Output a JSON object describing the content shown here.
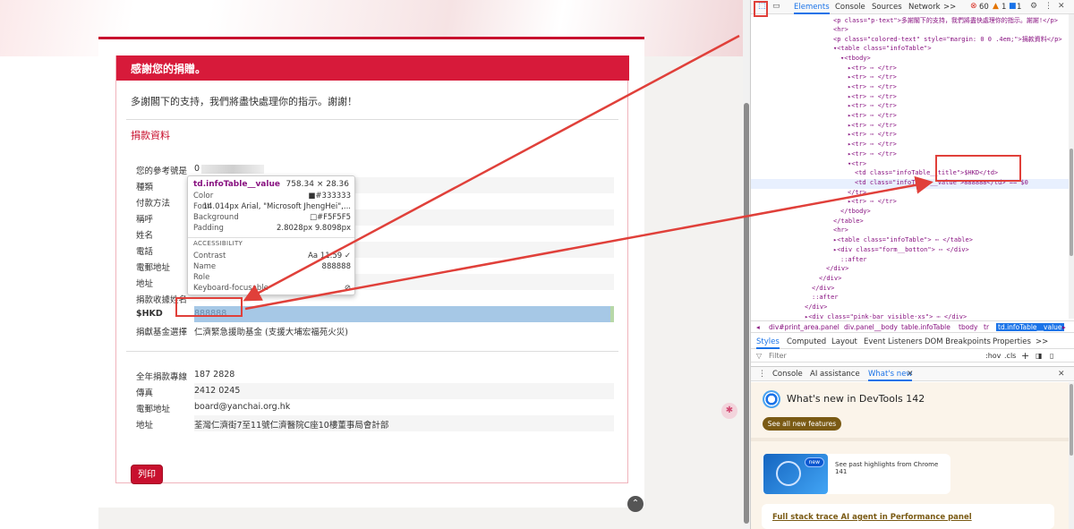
{
  "page": {
    "thank_title": "感謝您的捐贈。",
    "thank_text": "多謝閣下的支持，我們將盡快處理你的指示。謝謝！",
    "donation_heading": "捐款資料",
    "rows": [
      {
        "label": "您的參考號是",
        "value": "0"
      },
      {
        "label": "種類",
        "value": ""
      },
      {
        "label": "付款方法",
        "value": ""
      },
      {
        "label": "稱呼",
        "value": ""
      },
      {
        "label": "姓名",
        "value": ""
      },
      {
        "label": "電話",
        "value": ""
      },
      {
        "label": "電郵地址",
        "value": ""
      },
      {
        "label": "地址",
        "value": ""
      },
      {
        "label": "捐款收據姓名",
        "value": ""
      },
      {
        "label": "$HKD",
        "value": "888888"
      },
      {
        "label": "捐獻基金選擇",
        "value": "仁濟緊急援助基金 (支援大埔宏福苑火災)"
      }
    ],
    "contact_rows": [
      {
        "label": "全年捐款專線",
        "value": "187 2828"
      },
      {
        "label": "傳真",
        "value": "2412 0245"
      },
      {
        "label": "電郵地址",
        "value": "board@yanchai.org.hk"
      },
      {
        "label": "地址",
        "value": "荃灣仁濟街7至11號仁濟醫院C座10樓董事局會計部"
      }
    ],
    "print_label": "列印"
  },
  "tooltip": {
    "title": "td.infoTable__value",
    "size": "758.34 × 28.36",
    "color_label": "Color",
    "color_value": "■#333333",
    "font_label": "Font",
    "font_value": "14.014px Arial, \"Microsoft JhengHei\",...",
    "background_label": "Background",
    "background_value": "□#F5F5F5",
    "padding_label": "Padding",
    "padding_value": "2.8028px 9.8098px",
    "accessibility_label": "ACCESSIBILITY",
    "contrast_label": "Contrast",
    "contrast_value": "Aa 11.59 ✓",
    "name_label": "Name",
    "name_value": "888888",
    "role_label": "Role",
    "keyboard_label": "Keyboard-focusable",
    "keyboard_value": "⊘"
  },
  "devtools": {
    "tabs": [
      "Elements",
      "Console",
      "Sources",
      "Network"
    ],
    "more": ">>",
    "error_count": "60",
    "warning_count": "1",
    "info_count": "1",
    "code_lines": [
      {
        "indent": 0,
        "html": "<p class=\"p-text\">多謝閣下的支持，我們將盡快處理你的指示。謝謝!</p>"
      },
      {
        "indent": 0,
        "html": "<hr>"
      },
      {
        "indent": 0,
        "html": "<p class=\"colored-text\" style=\"margin: 0 0 .4em;\">捐款資料</p>"
      },
      {
        "indent": 0,
        "html": "▾<table class=\"infoTable\">"
      },
      {
        "indent": 1,
        "html": "▾<tbody>"
      },
      {
        "indent": 2,
        "html": "▸<tr> ⋯ </tr>"
      },
      {
        "indent": 2,
        "html": "▸<tr> ⋯ </tr>"
      },
      {
        "indent": 2,
        "html": "▸<tr> ⋯ </tr>"
      },
      {
        "indent": 2,
        "html": "▸<tr> ⋯ </tr>"
      },
      {
        "indent": 2,
        "html": "▸<tr> ⋯ </tr>"
      },
      {
        "indent": 2,
        "html": "▸<tr> ⋯ </tr>"
      },
      {
        "indent": 2,
        "html": "▸<tr> ⋯ </tr>"
      },
      {
        "indent": 2,
        "html": "▸<tr> ⋯ </tr>"
      },
      {
        "indent": 2,
        "html": "▸<tr> ⋯ </tr>"
      },
      {
        "indent": 2,
        "html": "▸<tr> ⋯ </tr>"
      },
      {
        "indent": 2,
        "html": "▾<tr>"
      },
      {
        "indent": 3,
        "html": "<td class=\"infoTable__title\">$HKD</td>"
      },
      {
        "indent": 3,
        "html": "<td class=\"infoTable__value\">888888</td> == $0"
      },
      {
        "indent": 2,
        "html": "</tr>"
      },
      {
        "indent": 2,
        "html": "▸<tr> ⋯ </tr>"
      },
      {
        "indent": 1,
        "html": "</tbody>"
      },
      {
        "indent": 0,
        "html": "</table>"
      },
      {
        "indent": 0,
        "html": "<hr>"
      },
      {
        "indent": 0,
        "html": "▸<table class=\"infoTable\"> ⋯ </table>"
      },
      {
        "indent": 0,
        "html": "▸<div class=\"form__botton\"> ⋯ </div>"
      },
      {
        "indent": 1,
        "html": "::after"
      },
      {
        "indent": -1,
        "html": "</div>"
      },
      {
        "indent": -2,
        "html": "</div>"
      },
      {
        "indent": -3,
        "html": "</div>"
      },
      {
        "indent": -3,
        "html": "::after"
      },
      {
        "indent": -4,
        "html": "</div>"
      },
      {
        "indent": -4,
        "html": "▸<div class=\"pink-bar visible-xs\"> ⋯ </div>"
      }
    ],
    "breadcrumbs": [
      "◂",
      "div#print_area.panel",
      "div.panel__body",
      "table.infoTable",
      "tbody",
      "tr",
      "td.infoTable__value",
      "▸"
    ],
    "style_tabs": [
      "Styles",
      "Computed",
      "Layout",
      "Event Listeners",
      "DOM Breakpoints",
      "Properties",
      ">>"
    ],
    "filter_placeholder": "Filter",
    "filter_tools": [
      ":hov",
      ".cls",
      "+"
    ],
    "drawer_tabs": [
      "Console",
      "AI assistance",
      "What's new"
    ],
    "whats_new_title": "What's new in DevTools 142",
    "see_all_features": "See all new features",
    "new_badge": "new",
    "highlights_text": "See past highlights from Chrome 141",
    "ai_agent_text": "Full stack trace AI agent in Performance panel"
  },
  "colors": {
    "brand_red": "#d71a3a",
    "selected_blue": "#a6c8e6",
    "annotation_red": "#e0403a",
    "devtools_accent": "#1a73e8"
  }
}
